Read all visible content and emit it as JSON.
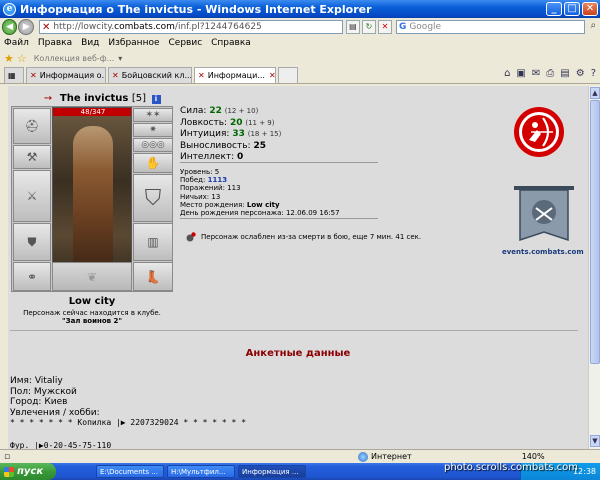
{
  "window": {
    "title": "Информация о The invictus - Windows Internet Explorer"
  },
  "address": {
    "prefix": "http://lowcity.",
    "domain": "combats.com",
    "path": "/inf.pl?1244764625"
  },
  "search": {
    "placeholder": "Google"
  },
  "menu": [
    "Файл",
    "Правка",
    "Вид",
    "Избранное",
    "Сервис",
    "Справка"
  ],
  "links": {
    "collection": "Коллекция веб-ф..."
  },
  "tabs": [
    {
      "label": "Информация о..."
    },
    {
      "label": "Бойцовский кл..."
    },
    {
      "label": "Информаци..."
    }
  ],
  "character": {
    "name": "The invictus",
    "level": "[5]",
    "info_badge": "i",
    "hp": "48/347",
    "location": "Low city",
    "club_text": "Персонаж сейчас находится в клубе.",
    "club_name": "\"Зал воинов 2\""
  },
  "stats": [
    {
      "label": "Сила:",
      "value": "22",
      "bonus": "(12 + 10)"
    },
    {
      "label": "Ловкость:",
      "value": "20",
      "bonus": "(11 + 9)"
    },
    {
      "label": "Интуиция:",
      "value": "33",
      "bonus": "(18 + 15)"
    },
    {
      "label": "Выносливость:",
      "value": "25",
      "bonus": ""
    },
    {
      "label": "Интеллект:",
      "value": "0",
      "bonus": ""
    }
  ],
  "details": {
    "level_label": "Уровень:",
    "level": "5",
    "wins_label": "Побед:",
    "wins": "1113",
    "losses_label": "Поражений:",
    "losses": "113",
    "draws_label": "Ничьих:",
    "draws": "13",
    "birthplace_label": "Место рождения:",
    "birthplace": "Low city",
    "birthday_label": "День рождения персонажа:",
    "birthday": "12.06.09 16:57"
  },
  "weakened": "Персонаж ослаблен из-за смерти в бою, еще 7 мин. 41 сек.",
  "events_link": "events.combats.com",
  "profile": {
    "title": "Анкетные данные",
    "name": "Имя: Vitaliy",
    "sex": "Пол: Мужской",
    "city": "Город: Киев",
    "hobby": "Увлечения / хобби:",
    "line1": "* * * * * * *   Копилка   |▶      2207329024    * * * * * * *",
    "phone": "Фур.   |▶0-20-45-75-110"
  },
  "status": {
    "zone": "Интернет",
    "zoom": "140%"
  },
  "taskbar": {
    "start": "пуск",
    "tasks": [
      "E:\\Documents ...",
      "H:\\Мультфил...",
      "Информация ..."
    ],
    "clock": "12:38"
  },
  "watermark": "photo.scrolls.combats.com",
  "colors": {
    "titlebar": "#0a5fd8",
    "section_title": "#8b0000",
    "stat_value": "#006600",
    "clan_red": "#d40000"
  }
}
